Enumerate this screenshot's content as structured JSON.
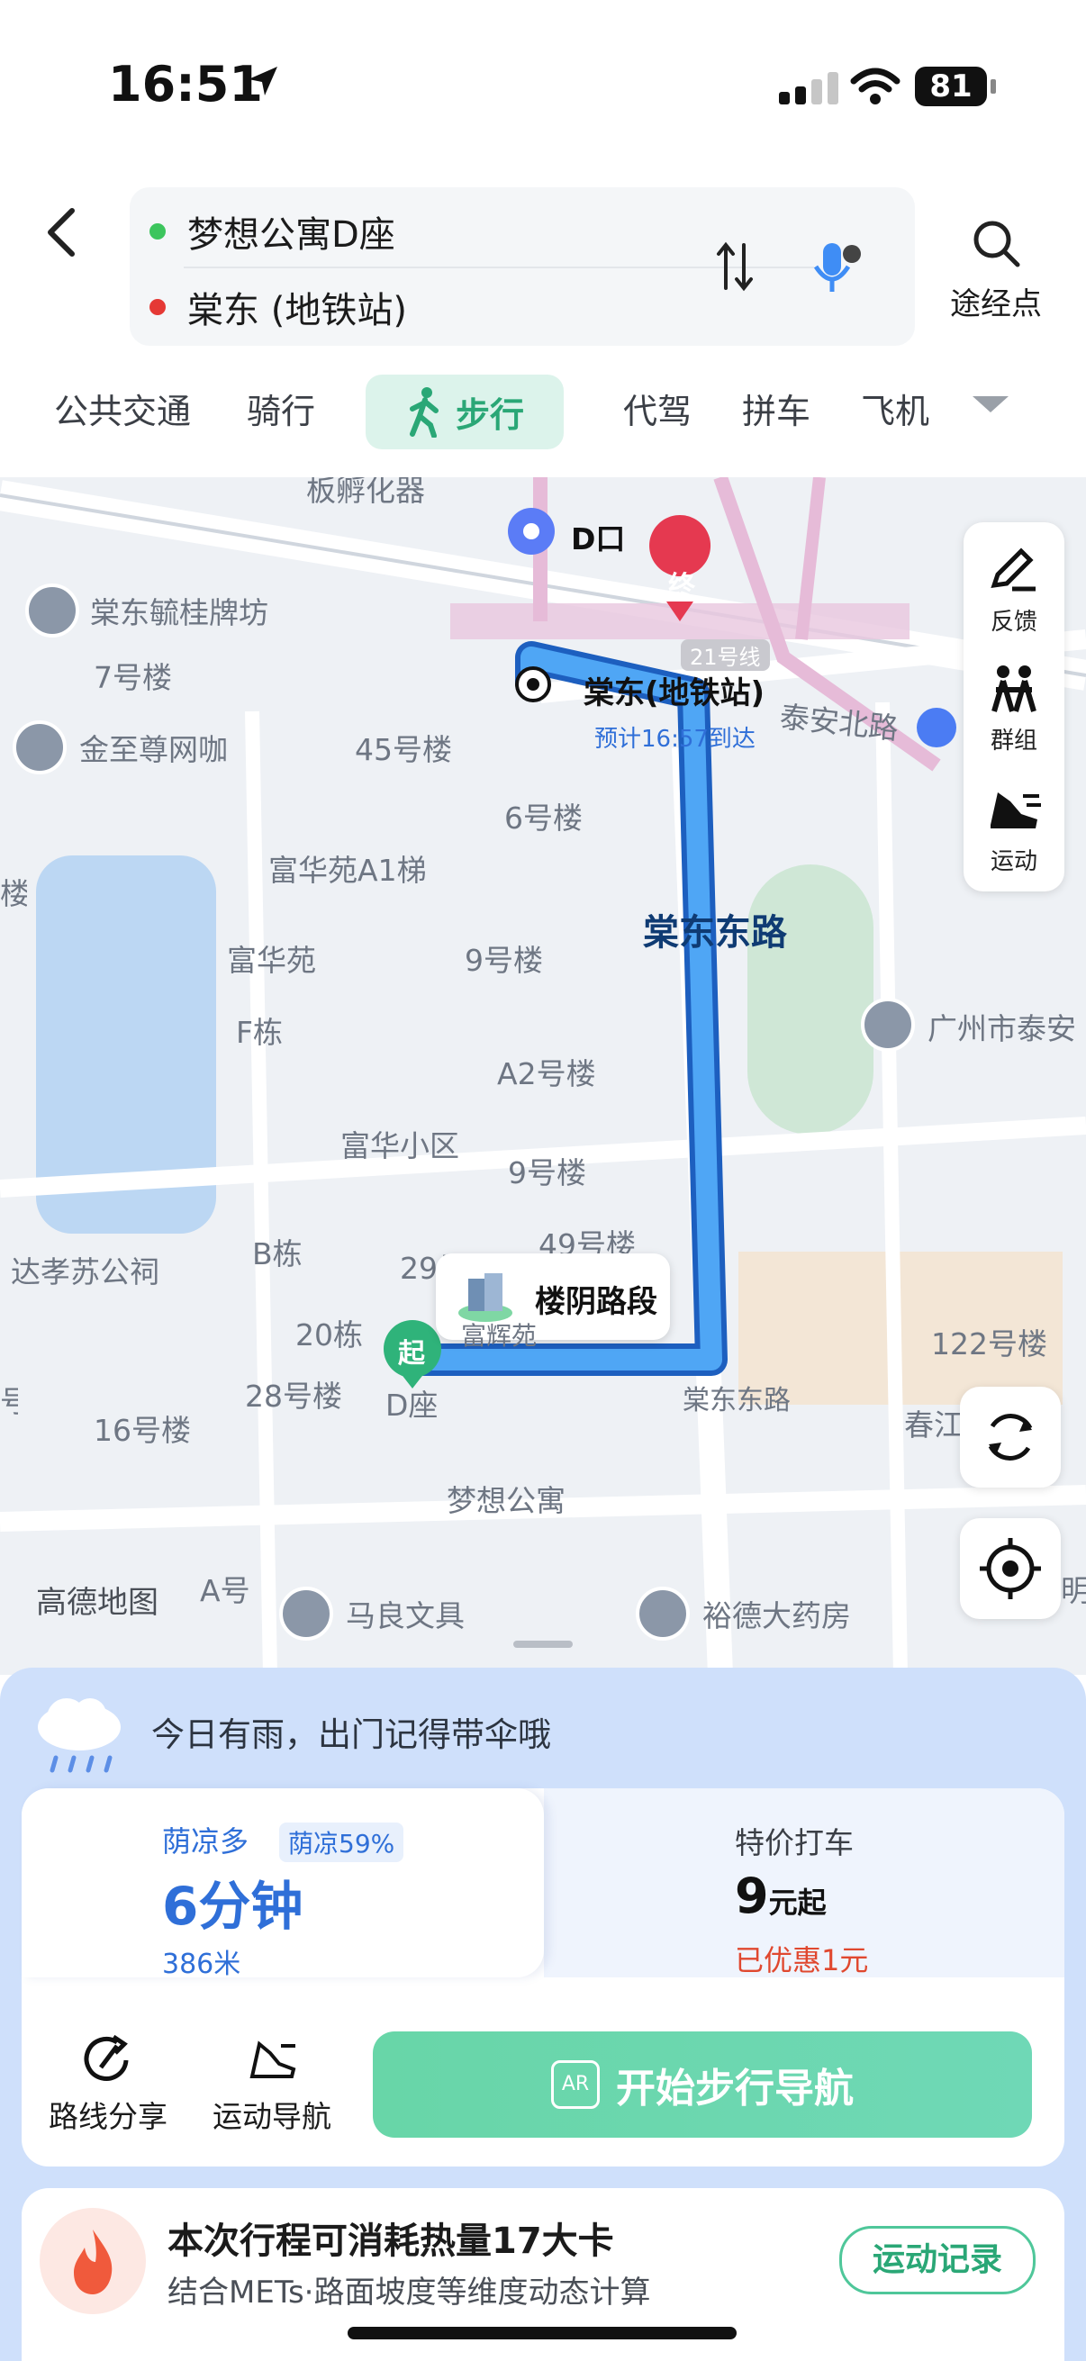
{
  "status_bar": {
    "time": "16:51",
    "battery": "81"
  },
  "route": {
    "from": "梦想公寓D座",
    "to": "棠东 (地铁站)",
    "waypoint_label": "途经点"
  },
  "tabs": [
    {
      "label": "公共交通"
    },
    {
      "label": "骑行"
    },
    {
      "label": "步行",
      "active": true
    },
    {
      "label": "代驾"
    },
    {
      "label": "拼车"
    },
    {
      "label": "飞机"
    }
  ],
  "map": {
    "labels": {
      "l1": "板孵化器",
      "l2": "D口",
      "l3": "棠东毓桂牌坊",
      "l4": "7号楼",
      "l5": "21号线",
      "l6": "棠东(地铁站)",
      "l7": "预计16:57到达",
      "l8": "泰安北路",
      "l9": "金至尊网咖",
      "l10": "45号楼",
      "l11": "6号楼",
      "l12": "富华苑A1梯",
      "l13": "富华苑",
      "l14": "9号楼",
      "l15": "F栋",
      "l16": "A2号楼",
      "l17": "广州市泰安",
      "l18": "富华小区",
      "l19": "9号楼",
      "l20": "B栋",
      "l21": "49号楼",
      "l22": "达孝苏公祠",
      "l23": "29号楼",
      "l24": "楼阴路段",
      "l25": "122号楼",
      "l26": "20栋",
      "l27": "28号楼",
      "l28": "D座",
      "l29": "16号楼",
      "l30": "春江",
      "l31": "梦想公寓",
      "l32": "A号",
      "l33": "马良文具",
      "l34": "裕德大药房",
      "l35": "棠东东路",
      "l36": "棠东东路",
      "l37": "号楼",
      "l38": "楼",
      "l39": "富辉苑",
      "l40": "明"
    },
    "start_marker": "起",
    "end_marker": "终",
    "logo": "高德地图"
  },
  "side_tools": [
    {
      "label": "反馈",
      "icon": "pencil-icon"
    },
    {
      "label": "群组",
      "icon": "group-icon"
    },
    {
      "label": "运动",
      "icon": "running-shoe-icon"
    }
  ],
  "weather": {
    "text": "今日有雨，出门记得带伞哦"
  },
  "route_option": {
    "shade_label": "荫凉多",
    "shade_percent": "荫凉59%",
    "duration": "6分钟",
    "distance": "386米"
  },
  "taxi_option": {
    "label": "特价打车",
    "price": "9",
    "price_unit": "元起",
    "discount": "已优惠1元"
  },
  "actions": {
    "share": "路线分享",
    "sport_nav": "运动导航",
    "start_nav": "开始步行导航",
    "ar_badge": "AR"
  },
  "calories": {
    "title": "本次行程可消耗热量17大卡",
    "subtitle": "结合METs·路面坡度等维度动态计算",
    "record_button": "运动记录"
  },
  "colors": {
    "accent_green": "#2aa776",
    "route_blue": "#3d9bef",
    "brand_blue": "#2f6fd8"
  }
}
